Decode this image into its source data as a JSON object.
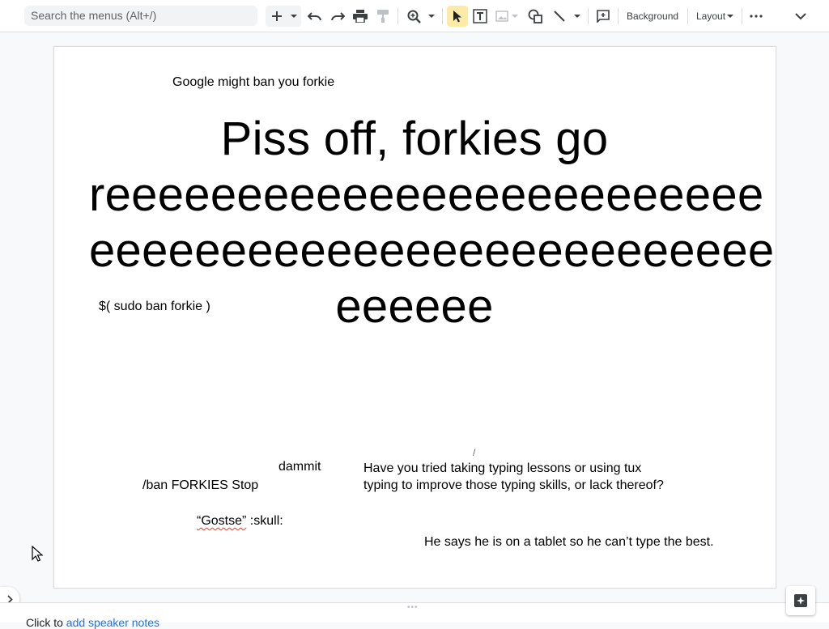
{
  "toolbar": {
    "search_placeholder": "Search the menus (Alt+/)",
    "background_label": "Background",
    "layout_label": "Layout",
    "icons": [
      "plus-icon",
      "dropdown-arrow-icon",
      "undo-icon",
      "redo-icon",
      "print-icon",
      "paint-format-icon",
      "zoom-icon",
      "dropdown-arrow-icon",
      "select-icon",
      "text-box-icon",
      "image-icon",
      "shape-icon",
      "line-icon",
      "comment-icon",
      "more-icon",
      "collapse-icon"
    ]
  },
  "slide": {
    "title_small": "Google might ban you forkie",
    "main_text": "Piss off, forkies go\nreeeeeeeeeeeeeeeeeeeeeeeee\neeeeeeeeeeeeeeeeeeeeeeeeee\neeeeee",
    "sudo_text": "$( sudo ban forkie )",
    "dammit_text": "dammit",
    "ban_text": "/ban FORKIES Stop",
    "gostse_word": "“Gostse”",
    "gostse_rest": " :skull:",
    "typing_line1": "Have you tried taking typing lessons or using tux",
    "typing_line2": "typing to improve those typing skills, or lack thereof?",
    "tablet_text": "He says he is on a tablet so he can’t type the best.",
    "slash_mark": "/"
  },
  "notes": {
    "prefix": "Click to ",
    "link": "add speaker notes"
  },
  "colors": {
    "accent_active": "#fdeaa7",
    "link": "#1a73e8",
    "spellcheck": "#d14836"
  }
}
